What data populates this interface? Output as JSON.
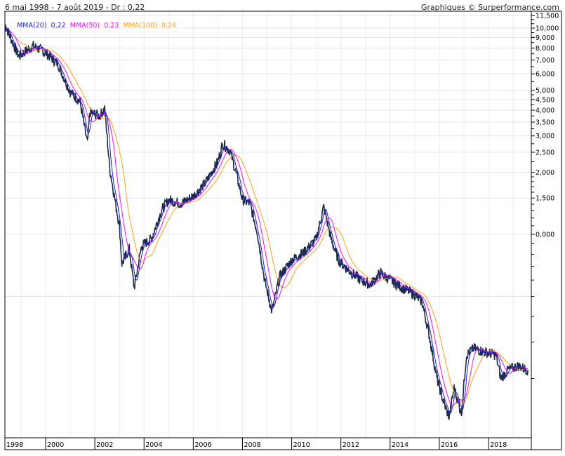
{
  "header": {
    "range": "6 mai 1998 - 7 août 2019 - Dr : 0,22",
    "credit": "Graphiques © Surperformance.com"
  },
  "legend": [
    {
      "label": "MMA(20)",
      "value": "0,22",
      "color": "#2020e0",
      "period": 20
    },
    {
      "label": "MMA(50)",
      "value": "0,23",
      "color": "#ee10ee",
      "period": 50
    },
    {
      "label": "MMA(100)",
      "value": "0,24",
      "color": "#ffa020",
      "period": 100
    }
  ],
  "chart_data": {
    "type": "line",
    "scale": "log",
    "price_color": "#1c2a44",
    "x_ticks": [
      "1998",
      "2000",
      "2002",
      "2004",
      "2006",
      "2008",
      "2010",
      "2012",
      "2014",
      "2016",
      "2018"
    ],
    "x_tick_values": [
      1998,
      2000,
      2002,
      2004,
      2006,
      2008,
      2010,
      2012,
      2014,
      2016,
      2018
    ],
    "xlim": [
      1998.35,
      2019.75
    ],
    "y_ticks": [
      {
        "v": 11.5,
        "label": "11,500"
      },
      {
        "v": 10,
        "label": "10,000"
      },
      {
        "v": 9,
        "label": "9,000"
      },
      {
        "v": 8,
        "label": "8,000"
      },
      {
        "v": 7,
        "label": "7,000"
      },
      {
        "v": 6,
        "label": "6,000"
      },
      {
        "v": 5,
        "label": "5,000"
      },
      {
        "v": 4.5,
        "label": "4,500"
      },
      {
        "v": 4,
        "label": "4,000"
      },
      {
        "v": 3.5,
        "label": "3,500"
      },
      {
        "v": 3,
        "label": "3,000"
      },
      {
        "v": 2.5,
        "label": "2,500"
      },
      {
        "v": 2,
        "label": "2,000"
      },
      {
        "v": 1.5,
        "label": "1,500"
      },
      {
        "v": 1,
        "label": "0,000"
      }
    ],
    "price": [
      [
        1998.35,
        10.4
      ],
      [
        1998.9,
        7.3
      ],
      [
        1999.5,
        8.2
      ],
      [
        2000,
        7.6
      ],
      [
        2000.5,
        6.7
      ],
      [
        2001,
        4.9
      ],
      [
        2001.4,
        4.4
      ],
      [
        2001.7,
        2.75
      ],
      [
        2001.8,
        3.9
      ],
      [
        2002.2,
        3.75
      ],
      [
        2002.4,
        4.1
      ],
      [
        2002.6,
        2.1
      ],
      [
        2003,
        1.1
      ],
      [
        2003.1,
        0.72
      ],
      [
        2003.4,
        0.85
      ],
      [
        2003.6,
        0.55
      ],
      [
        2003.9,
        0.88
      ],
      [
        2004.3,
        0.95
      ],
      [
        2004.7,
        1.3
      ],
      [
        2005,
        1.47
      ],
      [
        2005.5,
        1.41
      ],
      [
        2006,
        1.53
      ],
      [
        2006.5,
        1.78
      ],
      [
        2007,
        2.26
      ],
      [
        2007.2,
        2.75
      ],
      [
        2007.5,
        2.54
      ],
      [
        2007.8,
        1.86
      ],
      [
        2008,
        1.47
      ],
      [
        2008.3,
        1.41
      ],
      [
        2008.6,
        1.03
      ],
      [
        2008.9,
        0.6
      ],
      [
        2009.2,
        0.42
      ],
      [
        2009.5,
        0.62
      ],
      [
        2010,
        0.75
      ],
      [
        2010.5,
        0.82
      ],
      [
        2011,
        0.95
      ],
      [
        2011.3,
        1.36
      ],
      [
        2011.6,
        0.95
      ],
      [
        2011.9,
        0.75
      ],
      [
        2012.3,
        0.67
      ],
      [
        2012.8,
        0.6
      ],
      [
        2013.2,
        0.57
      ],
      [
        2013.6,
        0.65
      ],
      [
        2014,
        0.6
      ],
      [
        2014.5,
        0.55
      ],
      [
        2015,
        0.51
      ],
      [
        2015.3,
        0.47
      ],
      [
        2015.6,
        0.32
      ],
      [
        2015.9,
        0.2
      ],
      [
        2016.2,
        0.15
      ],
      [
        2016.4,
        0.13
      ],
      [
        2016.6,
        0.18
      ],
      [
        2016.9,
        0.135
      ],
      [
        2017.1,
        0.26
      ],
      [
        2017.4,
        0.28
      ],
      [
        2017.8,
        0.27
      ],
      [
        2018.3,
        0.26
      ],
      [
        2018.5,
        0.2
      ],
      [
        2018.8,
        0.22
      ],
      [
        2019.2,
        0.23
      ],
      [
        2019.6,
        0.22
      ]
    ]
  }
}
